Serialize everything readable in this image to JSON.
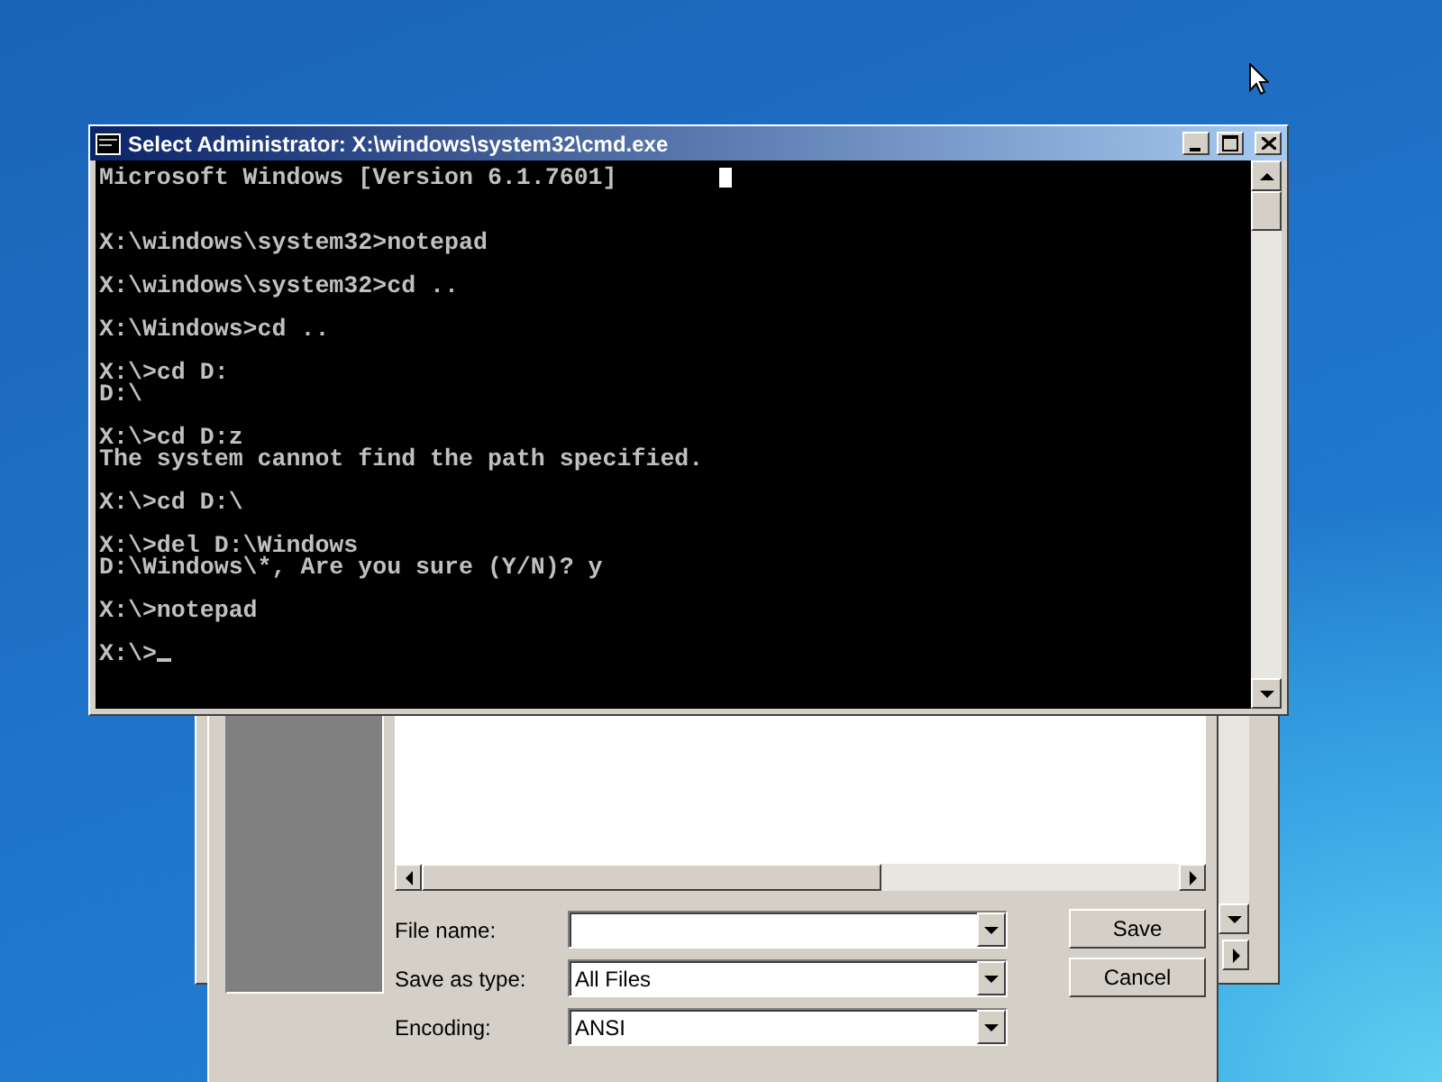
{
  "cmd_window": {
    "title": "Select Administrator: X:\\windows\\system32\\cmd.exe",
    "console_blocks": [
      {
        "kind": "banner",
        "lines": [
          "Microsoft Windows [Version 6.1.7601]"
        ]
      },
      {
        "kind": "output",
        "lines": [
          "X:\\windows\\system32>notepad"
        ]
      },
      {
        "kind": "output",
        "lines": [
          "X:\\windows\\system32>cd .."
        ]
      },
      {
        "kind": "output",
        "lines": [
          "X:\\Windows>cd .."
        ]
      },
      {
        "kind": "output",
        "lines": [
          "X:\\>cd D:",
          "D:\\"
        ]
      },
      {
        "kind": "output",
        "lines": [
          "X:\\>cd D:z",
          "The system cannot find the path specified."
        ]
      },
      {
        "kind": "output",
        "lines": [
          "X:\\>cd D:\\"
        ]
      },
      {
        "kind": "output",
        "lines": [
          "X:\\>del D:\\Windows",
          "D:\\Windows\\*, Are you sure (Y/N)? y"
        ]
      },
      {
        "kind": "output",
        "lines": [
          "X:\\>notepad"
        ]
      }
    ],
    "prompt": "X:\\>"
  },
  "save_dialog": {
    "fields": [
      {
        "label": "File name:"
      },
      {
        "label": "Save as type:",
        "value": "All Files"
      },
      {
        "label": "Encoding:",
        "value": "ANSI"
      }
    ],
    "buttons": [
      "Save",
      "Cancel"
    ]
  }
}
